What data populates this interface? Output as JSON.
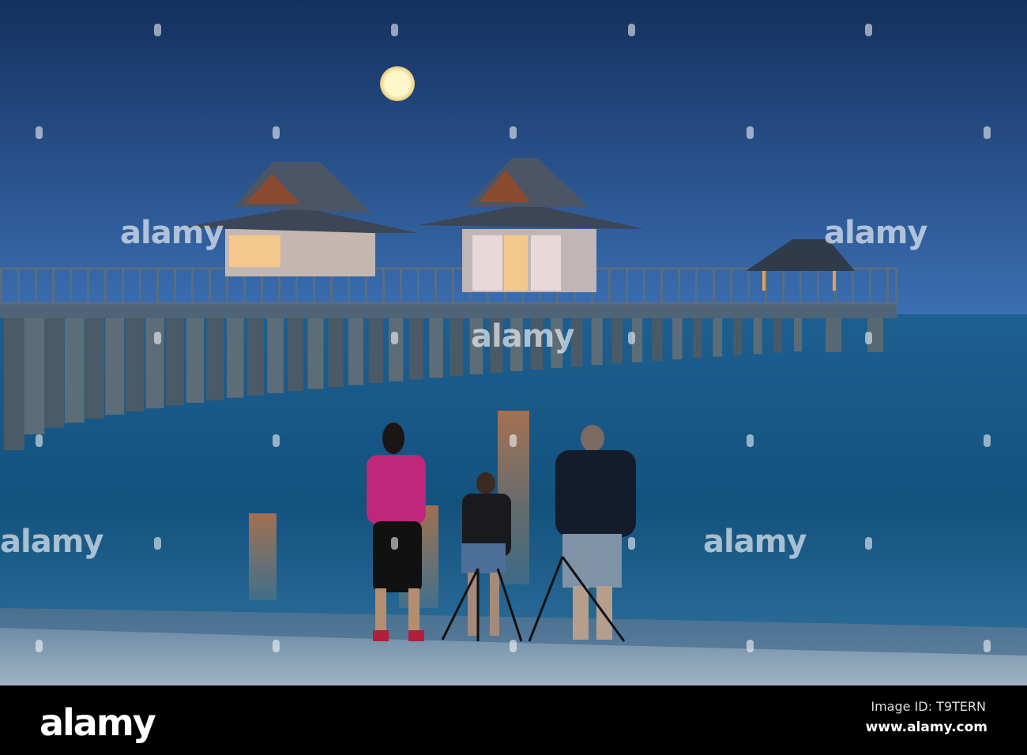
{
  "watermark": {
    "text": "alamy"
  },
  "footer": {
    "logo": "alamy",
    "image_id": "Image ID: T9TERN",
    "url": "www.alamy.com"
  },
  "colors": {
    "sky_top": "#0f2a55",
    "sky_horizon": "#3a6db0",
    "water": "#1c5b8a",
    "sand": "#8fa6b8",
    "moon": "#fff6c8"
  }
}
